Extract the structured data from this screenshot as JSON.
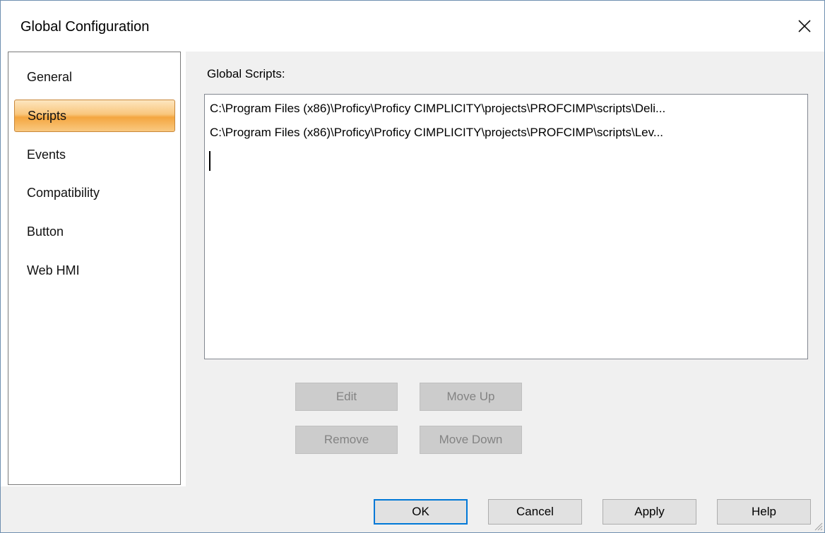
{
  "window": {
    "title": "Global Configuration",
    "close_icon": "close-icon"
  },
  "sidebar": {
    "items": [
      {
        "label": "General",
        "selected": false
      },
      {
        "label": "Scripts",
        "selected": true
      },
      {
        "label": "Events",
        "selected": false
      },
      {
        "label": "Compatibility",
        "selected": false
      },
      {
        "label": "Button",
        "selected": false
      },
      {
        "label": "Web HMI",
        "selected": false
      }
    ]
  },
  "main": {
    "label": "Global Scripts:",
    "scripts": [
      "C:\\Program Files (x86)\\Proficy\\Proficy CIMPLICITY\\projects\\PROFCIMP\\scripts\\Deli...",
      "C:\\Program Files (x86)\\Proficy\\Proficy CIMPLICITY\\projects\\PROFCIMP\\scripts\\Lev..."
    ],
    "buttons": {
      "edit": "Edit",
      "move_up": "Move Up",
      "remove": "Remove",
      "move_down": "Move Down"
    }
  },
  "footer": {
    "ok": "OK",
    "cancel": "Cancel",
    "apply": "Apply",
    "help": "Help"
  },
  "colors": {
    "selected_accent": "#f4a640",
    "default_button_border": "#0078d7",
    "disabled_text": "#838383"
  }
}
